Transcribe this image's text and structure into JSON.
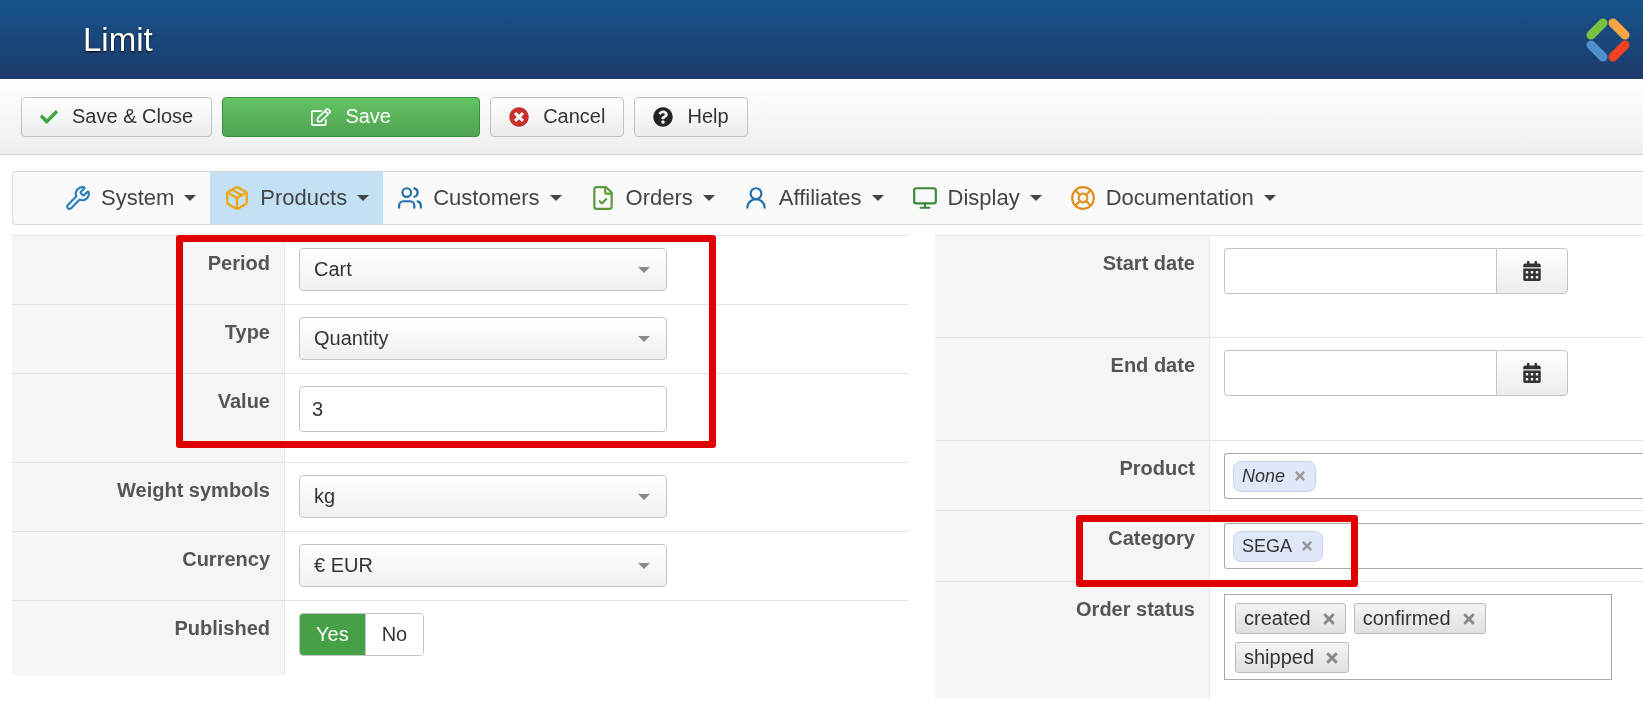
{
  "header": {
    "title": "Limit"
  },
  "toolbar": [
    {
      "kind": "check",
      "label": "Save & Close",
      "primary": false
    },
    {
      "kind": "edit",
      "label": "Save",
      "primary": true
    },
    {
      "kind": "cancel",
      "label": "Cancel",
      "primary": false
    },
    {
      "kind": "help",
      "label": "Help",
      "primary": false
    }
  ],
  "menu": [
    {
      "kind": "system",
      "label": "System",
      "selected": false
    },
    {
      "kind": "products",
      "label": "Products",
      "selected": true
    },
    {
      "kind": "customers",
      "label": "Customers",
      "selected": false
    },
    {
      "kind": "orders",
      "label": "Orders",
      "selected": false
    },
    {
      "kind": "affiliates",
      "label": "Affiliates",
      "selected": false
    },
    {
      "kind": "display",
      "label": "Display",
      "selected": false
    },
    {
      "kind": "documentation",
      "label": "Documentation",
      "selected": false
    }
  ],
  "left_fields": [
    {
      "kind": "select",
      "label": "Period",
      "value": "Cart",
      "highlighted": true
    },
    {
      "kind": "select",
      "label": "Type",
      "value": "Quantity",
      "highlighted": true
    },
    {
      "kind": "text",
      "label": "Value",
      "value": "3",
      "highlighted": true
    },
    {
      "kind": "select",
      "label": "Weight symbols",
      "value": "kg",
      "highlighted": false
    },
    {
      "kind": "select",
      "label": "Currency",
      "value": "€ EUR",
      "highlighted": false
    },
    {
      "kind": "toggle",
      "label": "Published",
      "highlighted": false,
      "options": [
        {
          "label": "Yes",
          "selected": true
        },
        {
          "label": "No",
          "selected": false
        }
      ]
    }
  ],
  "right_fields": [
    {
      "kind": "date",
      "label": "Start date",
      "highlighted": false
    },
    {
      "kind": "date",
      "label": "End date",
      "highlighted": false
    },
    {
      "kind": "chips",
      "label": "Product",
      "highlighted": false,
      "tags": [
        {
          "label": "None",
          "italic": true
        }
      ]
    },
    {
      "kind": "chips",
      "label": "Category",
      "highlighted": true,
      "tags": [
        {
          "label": "SEGA",
          "italic": false
        }
      ]
    },
    {
      "kind": "tags",
      "label": "Order status",
      "highlighted": false,
      "tags": [
        {
          "label": "created"
        },
        {
          "label": "confirmed"
        },
        {
          "label": "shipped"
        }
      ]
    }
  ]
}
